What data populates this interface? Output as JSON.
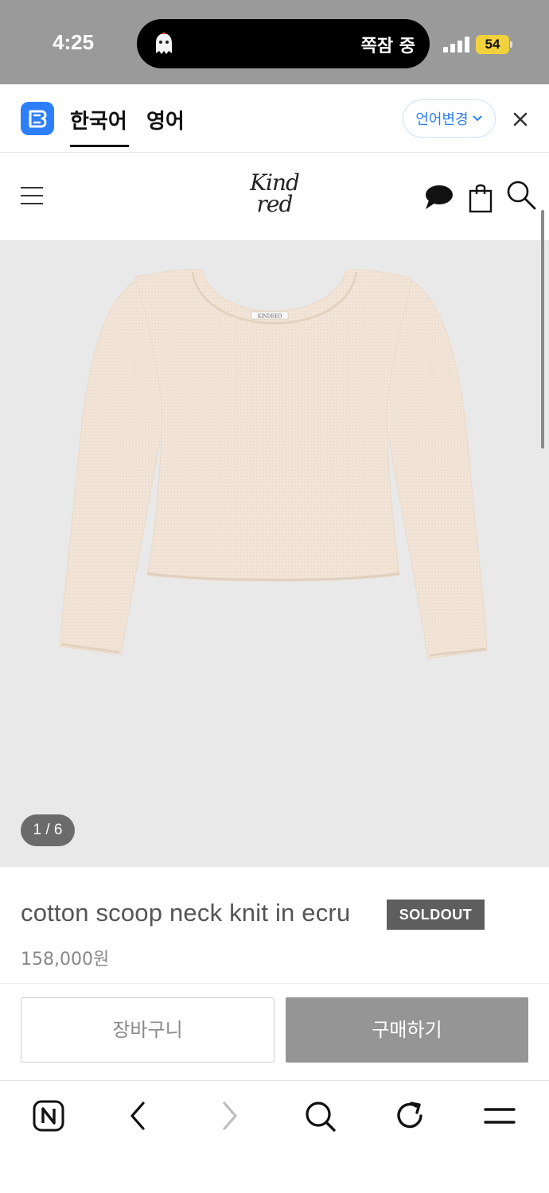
{
  "status_bar": {
    "time": "4:25",
    "activity_text": "쪽잠 중",
    "battery": "54"
  },
  "translate_bar": {
    "tabs": [
      {
        "label": "한국어",
        "active": true
      },
      {
        "label": "영어",
        "active": false
      }
    ],
    "change_language": "언어변경"
  },
  "header": {
    "brand_line1": "Kind",
    "brand_line2": "red"
  },
  "product": {
    "label_tag": "KINDRED",
    "image_counter": "1 / 6",
    "title": "cotton scoop neck knit in ecru",
    "badge": "SOLDOUT",
    "price": "158,000원"
  },
  "actions": {
    "cart": "장바구니",
    "buy": "구매하기"
  },
  "colors": {
    "accent": "#2d7ff9",
    "badge_bg": "#5e5e5e",
    "buy_bg": "#959595",
    "image_bg": "#e9e9e9",
    "sweater": "#f1e3d6"
  }
}
